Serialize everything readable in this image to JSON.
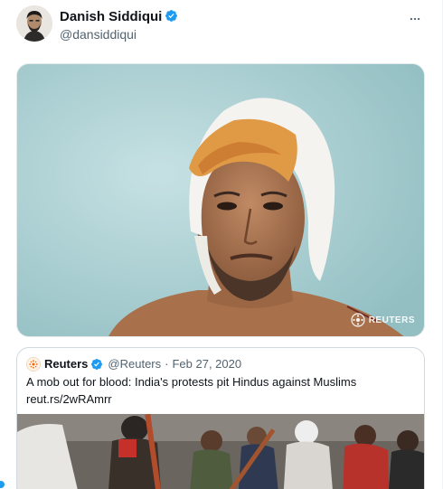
{
  "author": {
    "name": "Danish Siddiqui",
    "handle": "@dansiddiqui",
    "verified_icon": "verified-badge-icon",
    "more_icon": "more-options-icon"
  },
  "media": {
    "watermark": "REUTERS"
  },
  "quoted": {
    "name": "Reuters",
    "handle": "@Reuters",
    "separator": "·",
    "date": "Feb 27, 2020",
    "text": "A mob out for blood: India's protests pit Hindus against Muslims",
    "link": "reut.rs/2wRAmrr"
  },
  "colors": {
    "verified": "#1d9bf0",
    "text_primary": "#0f1419",
    "text_secondary": "#536471",
    "border": "#cfd9de",
    "reuters_orange": "#fa6400"
  }
}
